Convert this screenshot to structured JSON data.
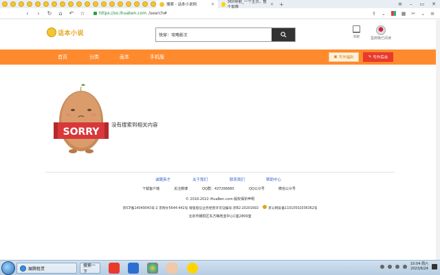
{
  "browser": {
    "tabs": [
      {
        "title": "搜索 - 话本小说网",
        "active": true
      },
      {
        "title": "360导航_一个主页，整个世界",
        "active": false
      }
    ],
    "url_host": "https://so.ihuaben.com",
    "url_path": "/search#",
    "window_controls": [
      "≡",
      "–",
      "▭",
      "✕"
    ]
  },
  "site": {
    "logo_text": "话本小说",
    "search": {
      "value": "快穿：攻略影王",
      "placeholder": ""
    },
    "shelf_label": "书架",
    "user_label": "墨辞晚已阅读"
  },
  "nav": {
    "items": [
      "首页",
      "分类",
      "画本",
      "手机版"
    ],
    "write_welfare": "写作福利",
    "write_admin": "写作后台"
  },
  "empty_state": {
    "sorry_text": "SORRY",
    "message": "没有搜索到相关内容"
  },
  "footer": {
    "links": [
      "诚聘英才",
      "关于我们",
      "联系我们",
      "帮助中心"
    ],
    "row2": [
      "下载客户端",
      "关注微博",
      "QQ群：437266680",
      "QQ公众号",
      "微信公众号"
    ],
    "copyright": "© 2016-2022 iHuaBen.com 版权保护声明",
    "license_1": "京ICP备14049043号-2 京网文5644-442号 增值电信业务经营许可证编号:京B2-20201692",
    "license_2": "京公网安备11010502036362号",
    "address": "北京市朝阳区东方梅地亚中心C座2809室"
  },
  "taskbar": {
    "task_title": "展腾租赁",
    "search_label": "搜索一下",
    "time": "10:04 周六",
    "date": "2023/6/24"
  },
  "colors": {
    "nav_orange": "#ff8a2e",
    "write_admin_red": "#e8392b",
    "link_blue": "#3366cc"
  }
}
